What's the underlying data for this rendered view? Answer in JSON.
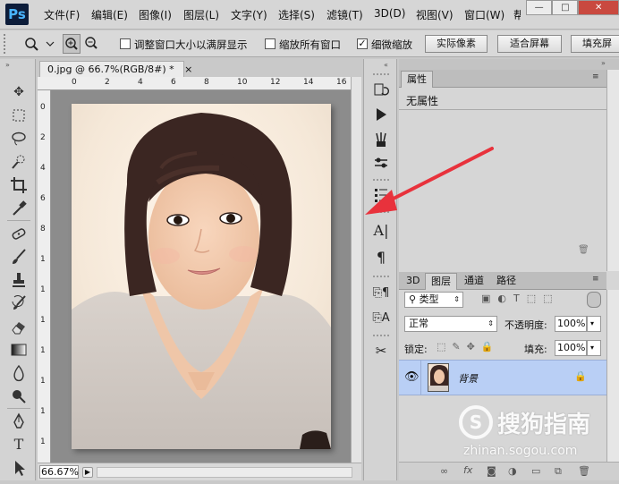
{
  "app": {
    "logo": "Ps"
  },
  "menu": [
    "文件(F)",
    "编辑(E)",
    "图像(I)",
    "图层(L)",
    "文字(Y)",
    "选择(S)",
    "滤镜(T)",
    "3D(D)",
    "视图(V)",
    "窗口(W)",
    "帮"
  ],
  "window_controls": {
    "minimize": "—",
    "maximize": "□",
    "close": "✕"
  },
  "options_bar": {
    "resize_windows_label": "调整窗口大小以满屏显示",
    "resize_windows_checked": false,
    "zoom_all_label": "缩放所有窗口",
    "zoom_all_checked": false,
    "scrubby_zoom_label": "细微缩放",
    "scrubby_zoom_checked": true,
    "actual_pixels": "实际像素",
    "fit_screen": "适合屏幕",
    "fill_screen": "填充屏"
  },
  "document": {
    "tab_title": "0.jpg @ 66.7%(RGB/8#) *",
    "close": "×",
    "zoom": "66.67%",
    "ruler_h": [
      "0",
      "2",
      "4",
      "6",
      "8",
      "10",
      "12",
      "14",
      "16"
    ],
    "ruler_v": [
      "0",
      "2",
      "4",
      "6",
      "8",
      "1",
      "1",
      "1",
      "1",
      "1",
      "1",
      "1"
    ]
  },
  "properties_panel": {
    "tab": "属性",
    "content": "无属性"
  },
  "layers_panel": {
    "tabs": [
      "3D",
      "图层",
      "通道",
      "路径"
    ],
    "active_tab": "图层",
    "filter_kind": "类型",
    "blend_mode": "正常",
    "opacity_label": "不透明度:",
    "opacity_value": "100%",
    "lock_label": "锁定:",
    "fill_label": "填充:",
    "fill_value": "100%",
    "layers": [
      {
        "name": "背景",
        "visible": true,
        "locked": true
      }
    ]
  },
  "watermark": {
    "brand": "搜狗指南",
    "url": "zhinan.sogou.com"
  },
  "colors": {
    "accent_arrow": "#e8323c",
    "selected_layer": "#b9cff5",
    "ps_logo_bg": "#0d1d3a",
    "ps_logo_fg": "#49b5ff"
  }
}
